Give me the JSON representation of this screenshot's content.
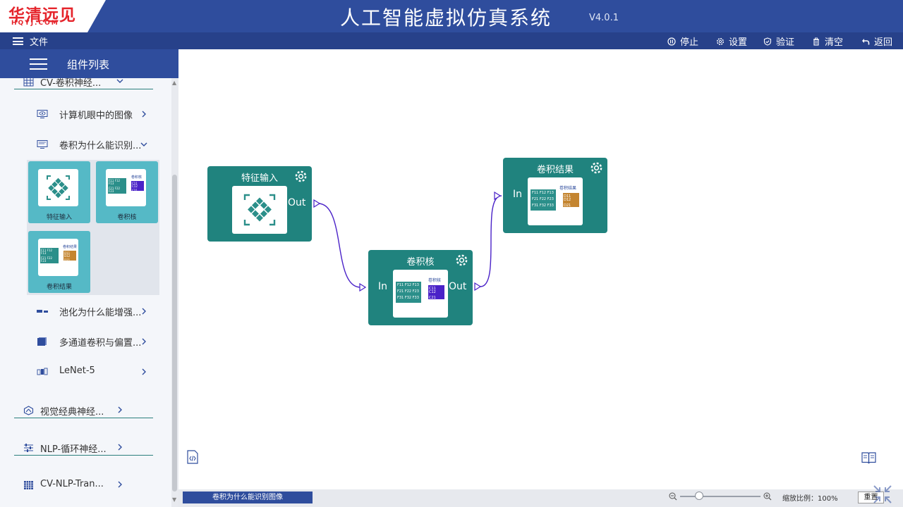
{
  "header": {
    "logo_text": "华清远见",
    "logo_sub": "HQYJ.COM",
    "title": "人工智能虚拟仿真系统",
    "version": "V4.0.1"
  },
  "menubar": {
    "file": "文件",
    "stop": "停止",
    "settings": "设置",
    "verify": "验证",
    "clear": "清空",
    "back": "返回"
  },
  "sidebar": {
    "title": "组件列表",
    "categories": [
      {
        "label": "CV-卷积神经..."
      },
      {
        "label": "视觉经典神经..."
      },
      {
        "label": "NLP-循环神经..."
      },
      {
        "label": "CV-NLP-Tran..."
      }
    ],
    "subitems": [
      {
        "label": "计算机眼中的图像"
      },
      {
        "label": "卷积为什么能识别..."
      },
      {
        "label": "池化为什么能增强..."
      },
      {
        "label": "多通道卷积与偏置..."
      },
      {
        "label": "LeNet-5"
      }
    ],
    "palette": [
      {
        "label": "特征输入"
      },
      {
        "label": "卷积核"
      },
      {
        "label": "卷积结果"
      }
    ]
  },
  "canvas": {
    "nodes": [
      {
        "title": "特征输入",
        "out_label": "Out"
      },
      {
        "title": "卷积核",
        "in_label": "In",
        "out_label": "Out"
      },
      {
        "title": "卷积结果",
        "in_label": "In"
      }
    ]
  },
  "mini": {
    "f_rows": [
      "F11 F12 F13",
      "F21 F22 F23",
      "F31 F32 F33"
    ],
    "kernel_title": "卷积核",
    "kernel_rows": [
      "C11 C12",
      "C21 C22"
    ],
    "result_title": "卷积结果",
    "result_rows": [
      "D11 D12",
      "D21 D22"
    ]
  },
  "statusbar": {
    "tab": "卷积为什么能识别图像",
    "zoom_label": "缩放比例：100%",
    "zoom": 1.0,
    "reset": "重置"
  },
  "colors": {
    "header_blue": "#2f4d9d",
    "node_teal": "#20837e",
    "palette_teal": "#55b9c6",
    "wire_purple": "#4a22c8",
    "logo_red": "#e5242b"
  }
}
